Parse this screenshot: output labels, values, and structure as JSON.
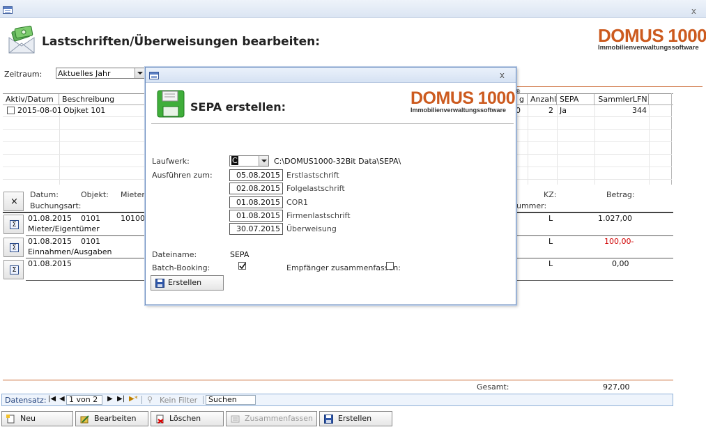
{
  "window": {
    "close_glyph": "x"
  },
  "header": {
    "title": "Lastschriften/Überweisungen bearbeiten:"
  },
  "logo": {
    "word": "DOMUS",
    "number": "1000",
    "reg": "®",
    "subtitle": "Immobilienverwaltungssoftware"
  },
  "filter": {
    "label": "Zeitraum:",
    "value": "Aktuelles Jahr"
  },
  "grid": {
    "columns": [
      "Aktiv/Datum",
      "Beschreibung",
      "g",
      "Anzahl",
      "SEPA",
      "SammlerLFN"
    ],
    "rows": [
      {
        "datum": "2015-08-01",
        "beschreibung": "Objket 101",
        "g": "0",
        "anzahl": "2",
        "sepa": "Ja",
        "sammler": "344"
      }
    ]
  },
  "details": {
    "close_glyph": "×",
    "hdr_datum": "Datum:",
    "hdr_objekt": "Objekt:",
    "hdr_mieter": "Mieter:",
    "hdr_buchungsart": "Buchungsart:",
    "hdr_kz": "KZ:",
    "hdr_betrag": "Betrag:",
    "hdr_nummer": "ummer:",
    "rows": [
      {
        "datum": "01.08.2015",
        "objekt": "0101",
        "mieter": "10100",
        "art": "Mieter/Eigentümer",
        "kz": "L",
        "betrag": "1.027,00",
        "negative": false
      },
      {
        "datum": "01.08.2015",
        "objekt": "0101",
        "mieter": "",
        "art": "Einnahmen/Ausgaben",
        "kz": "L",
        "betrag": "100,00-",
        "negative": true
      },
      {
        "datum": "01.08.2015",
        "objekt": "",
        "mieter": "",
        "art": "",
        "kz": "L",
        "betrag": "0,00",
        "negative": false
      }
    ],
    "sigma_glyph": "Σ"
  },
  "total": {
    "label": "Gesamt:",
    "value": "927,00"
  },
  "navigation": {
    "label": "Datensatz:",
    "position": "1 von 2",
    "filter": "Kein Filter",
    "search": "Suchen"
  },
  "buttons": {
    "neu": "Neu",
    "bearbeiten": "Bearbeiten",
    "loeschen": "Löschen",
    "zusammenfassen": "Zusammenfassen",
    "erstellen": "Erstellen"
  },
  "dialog": {
    "close_glyph": "x",
    "title": "SEPA erstellen:",
    "laufwerk_label": "Laufwerk:",
    "laufwerk_value": "C",
    "laufwerk_path": "C:\\DOMUS1000-32Bit Data\\SEPA\\",
    "ausfuehren_label": "Ausführen zum:",
    "dates": [
      {
        "date": "05.08.2015",
        "label": "Erstlastschrift"
      },
      {
        "date": "02.08.2015",
        "label": "Folgelastschrift"
      },
      {
        "date": "01.08.2015",
        "label": "COR1"
      },
      {
        "date": "01.08.2015",
        "label": "Firmenlastschrift"
      },
      {
        "date": "30.07.2015",
        "label": "Überweisung"
      }
    ],
    "dateiname_label": "Dateiname:",
    "dateiname_value": "SEPA",
    "batch_label": "Batch-Booking:",
    "batch_checked": true,
    "empfaenger_label": "Empfänger zusammenfassen:",
    "empfaenger_checked": false,
    "erstellen_label": "Erstellen"
  },
  "colors": {
    "accent_orange": "#cc5a1e",
    "negative_red": "#d00000",
    "title_blue": "#d6e2f3"
  }
}
